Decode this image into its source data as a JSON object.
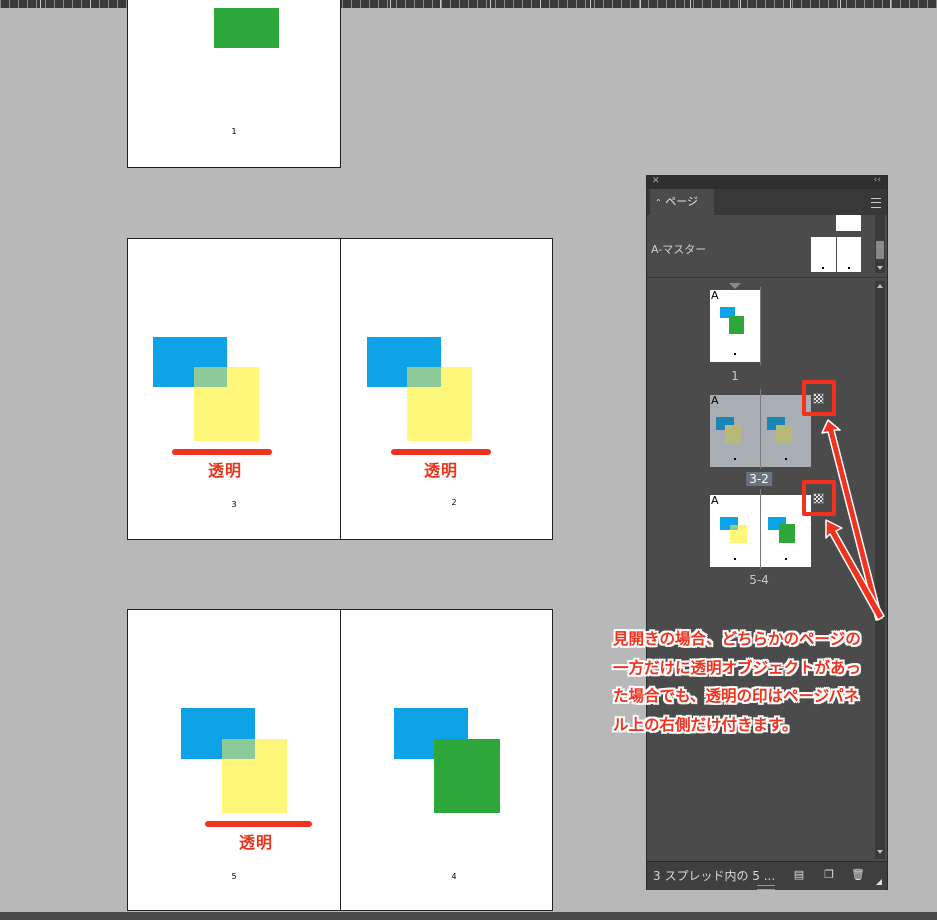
{
  "document": {
    "page_numbers": [
      "1",
      "3",
      "2",
      "5",
      "4"
    ],
    "transparency_label": "透明"
  },
  "pages_panel": {
    "close_glyph": "✕",
    "collapse_glyph": "‹‹",
    "tab_label": "ページ",
    "tab_glyph": "⌃",
    "master_label": "A-マスター",
    "master_letter": "A",
    "spreads": [
      {
        "label": "1",
        "selected": false
      },
      {
        "label": "3-2",
        "selected": true
      },
      {
        "label": "5-4",
        "selected": false
      }
    ],
    "status_text": "3 スプレッド内の 5 ..."
  },
  "annotation": {
    "lines": [
      "見開きの場合、どちらかのページの",
      "一方だけに透明オブジェクトがあっ",
      "た場合でも、透明の印はページパネ",
      "ル上の右側だけ付きます。"
    ]
  },
  "colors": {
    "annotation_red": "#f0321e",
    "canvas_gray": "#b8b8b8",
    "panel_bg": "#4b4b4b",
    "shape_blue": "#0ea2e6",
    "shape_yellow": "#fff77a",
    "shape_green": "#2ea83a"
  },
  "icons": [
    "close-icon",
    "collapse-icon",
    "panel-menu-icon",
    "transparency-icon",
    "edit-page-size-icon",
    "new-page-icon",
    "delete-page-icon",
    "resize-grip-icon"
  ]
}
